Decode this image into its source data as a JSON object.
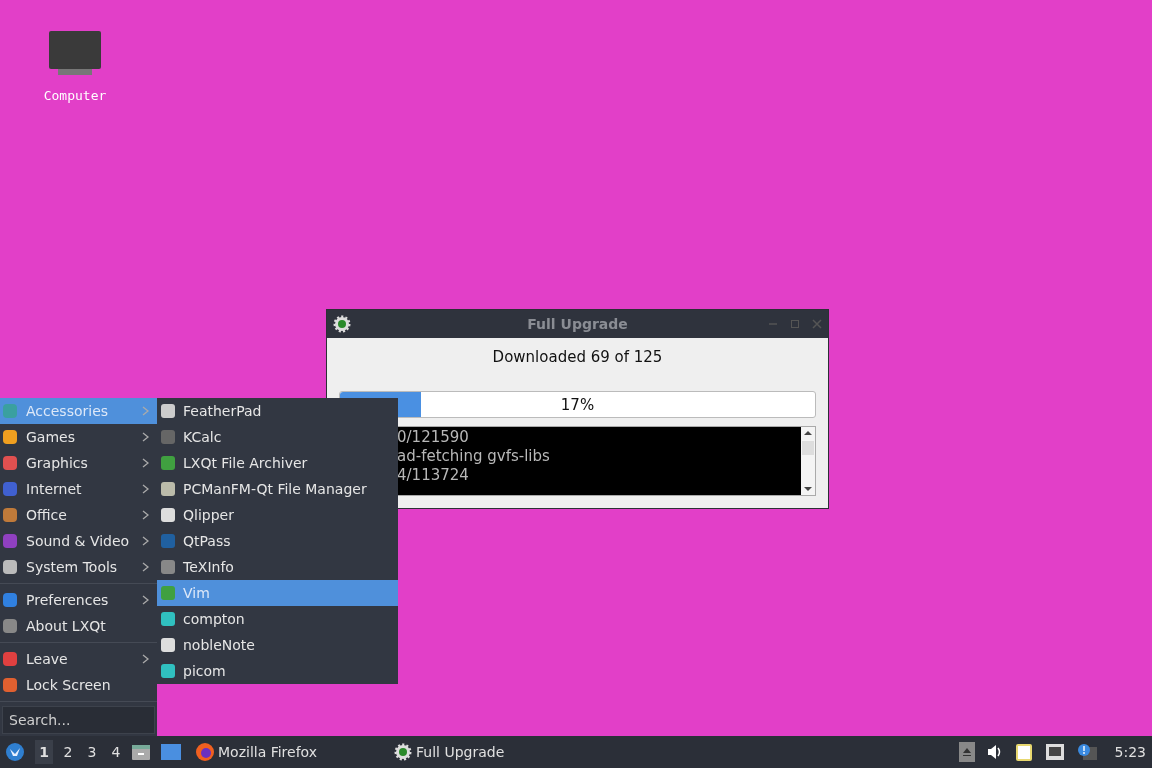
{
  "desktop_icons": [
    {
      "label": "Computer"
    }
  ],
  "window": {
    "title": "Full Upgrade",
    "message": "Downloaded 69 of 125",
    "progress": {
      "level": 0.17,
      "text": "17%"
    },
    "log_lines": [
      "0/121590",
      "ad-fetching gvfs-libs",
      "4/113724"
    ]
  },
  "start_menu": {
    "sections": [
      [
        {
          "label": "Accessories",
          "has_submenu": true,
          "selected": true
        },
        {
          "label": "Games",
          "has_submenu": true,
          "selected": false
        },
        {
          "label": "Graphics",
          "has_submenu": true,
          "selected": false
        },
        {
          "label": "Internet",
          "has_submenu": true,
          "selected": false
        },
        {
          "label": "Office",
          "has_submenu": true,
          "selected": false
        },
        {
          "label": "Sound & Video",
          "has_submenu": true,
          "selected": false
        },
        {
          "label": "System Tools",
          "has_submenu": true,
          "selected": false
        }
      ],
      [
        {
          "label": "Preferences",
          "has_submenu": true,
          "selected": false
        },
        {
          "label": "About LXQt",
          "has_submenu": false,
          "selected": false
        }
      ],
      [
        {
          "label": "Leave",
          "has_submenu": true,
          "selected": false
        },
        {
          "label": "Lock Screen",
          "has_submenu": false,
          "selected": false
        }
      ]
    ],
    "search": {
      "placeholder": "Search..."
    }
  },
  "submenu": {
    "items": [
      {
        "label": "FeatherPad",
        "selected": false
      },
      {
        "label": "KCalc",
        "selected": false
      },
      {
        "label": "LXQt File Archiver",
        "selected": false
      },
      {
        "label": "PCManFM-Qt File Manager",
        "selected": false
      },
      {
        "label": "Qlipper",
        "selected": false
      },
      {
        "label": "QtPass",
        "selected": false
      },
      {
        "label": "TeXInfo",
        "selected": false
      },
      {
        "label": "Vim",
        "selected": true
      },
      {
        "label": "compton",
        "selected": false
      },
      {
        "label": "nobleNote",
        "selected": false
      },
      {
        "label": "picom",
        "selected": false
      }
    ]
  },
  "taskbar": {
    "workspaces": [
      {
        "label": "1",
        "selected": true
      },
      {
        "label": "2",
        "selected": false
      },
      {
        "label": "3",
        "selected": false
      },
      {
        "label": "4",
        "selected": false
      }
    ],
    "tasks": [
      {
        "label": "Mozilla Firefox"
      },
      {
        "label": "Full Upgrade"
      }
    ],
    "clock": "5:23"
  }
}
